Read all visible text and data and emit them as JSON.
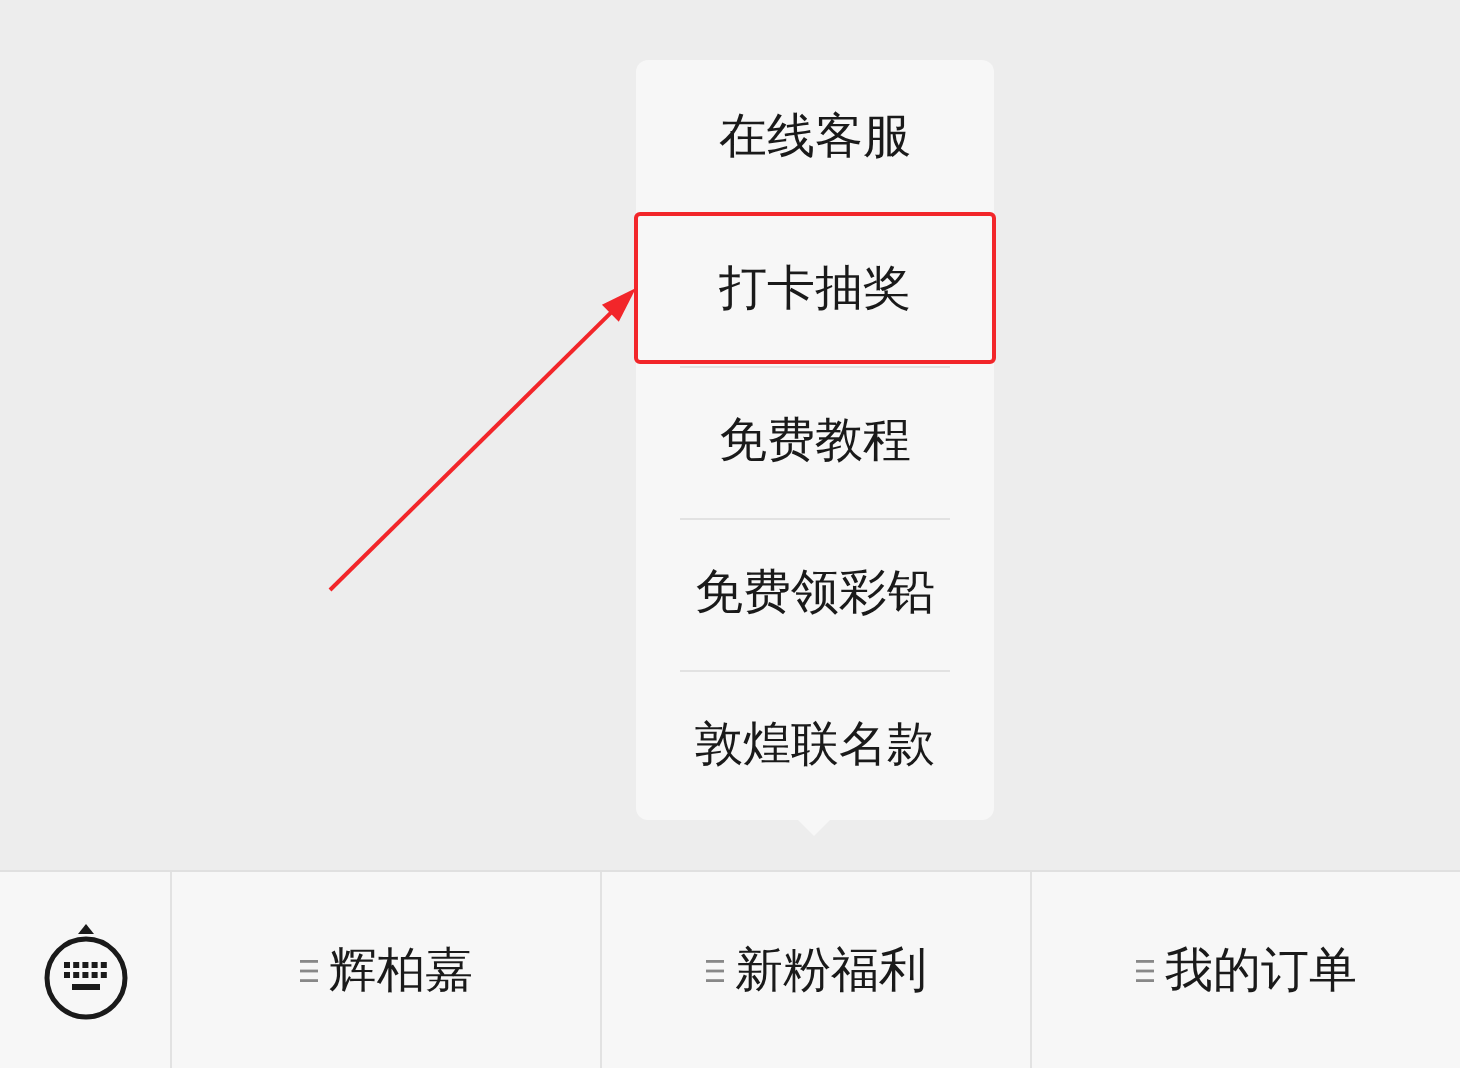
{
  "popup_menu": {
    "items": [
      {
        "label": "在线客服",
        "highlighted": false
      },
      {
        "label": "打卡抽奖",
        "highlighted": true
      },
      {
        "label": "免费教程",
        "highlighted": false
      },
      {
        "label": "免费领彩铅",
        "highlighted": false
      },
      {
        "label": "敦煌联名款",
        "highlighted": false
      }
    ]
  },
  "bottom_menu": {
    "items": [
      {
        "label": "辉柏嘉"
      },
      {
        "label": "新粉福利"
      },
      {
        "label": "我的订单"
      }
    ]
  }
}
